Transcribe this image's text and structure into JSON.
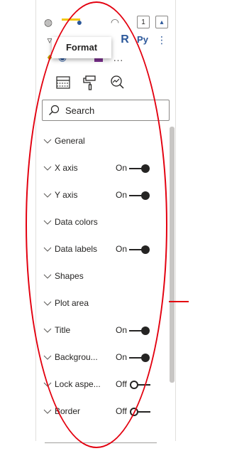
{
  "tooltip": {
    "title": "Format"
  },
  "viz_icons": {
    "r_visual": "R",
    "python_visual": "Py",
    "more": "…"
  },
  "tabs": [
    {
      "name": "fields-tab-icon"
    },
    {
      "name": "format-paint-roller-icon",
      "selected": true
    },
    {
      "name": "analytics-magnifier-icon"
    }
  ],
  "search": {
    "placeholder": "Search"
  },
  "sections": [
    {
      "label": "General",
      "state": ""
    },
    {
      "label": "X axis",
      "state": "On"
    },
    {
      "label": "Y axis",
      "state": "On"
    },
    {
      "label": "Data colors",
      "state": ""
    },
    {
      "label": "Data labels",
      "state": "On"
    },
    {
      "label": "Shapes",
      "state": ""
    },
    {
      "label": "Plot area",
      "state": ""
    },
    {
      "label": "Title",
      "state": "On"
    },
    {
      "label": "Backgrou...",
      "state": "On"
    },
    {
      "label": "Lock aspe...",
      "state": "Off"
    },
    {
      "label": "Border",
      "state": "Off"
    }
  ],
  "colors": {
    "accent": "#f2c811",
    "annotation": "#e3000f",
    "toggle": "#252423"
  }
}
